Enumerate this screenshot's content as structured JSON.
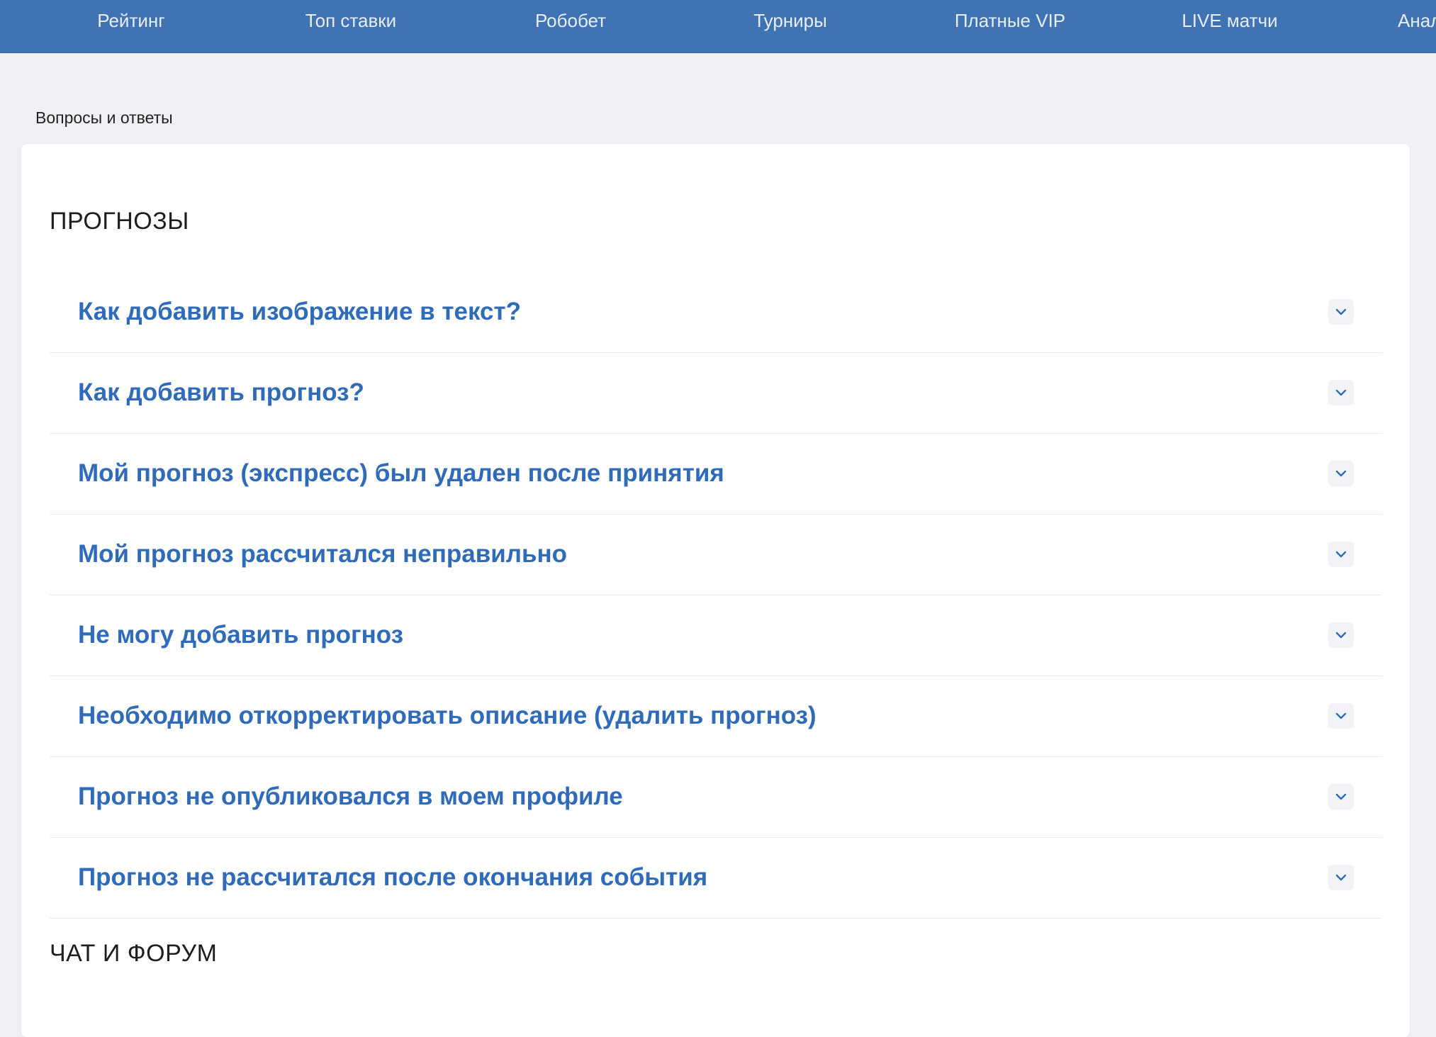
{
  "nav": {
    "items": [
      {
        "label": "Рейтинг"
      },
      {
        "label": "Топ ставки"
      },
      {
        "label": "Робобет"
      },
      {
        "label": "Турниры"
      },
      {
        "label": "Платные VIP"
      },
      {
        "label": "LIVE матчи"
      },
      {
        "label": "Анал"
      }
    ]
  },
  "breadcrumb": {
    "label": "Вопросы и ответы"
  },
  "sections": [
    {
      "title": "ПРОГНОЗЫ",
      "questions": [
        "Как добавить изображение в текст?",
        "Как добавить прогноз?",
        "Мой прогноз (экспресс) был удален после принятия",
        "Мой прогноз рассчитался неправильно",
        "Не могу добавить прогноз",
        "Необходимо откорректировать описание (удалить прогноз)",
        "Прогноз не опубликовался в моем профиле",
        "Прогноз не рассчитался после окончания события"
      ]
    },
    {
      "title": "ЧАТ И ФОРУМ",
      "questions": []
    }
  ],
  "icons": {
    "toggle": "chevron-down-icon"
  },
  "colors": {
    "nav_bg": "#3f73b4",
    "question_text": "#2f6bb9",
    "page_bg": "#eef0f3"
  }
}
